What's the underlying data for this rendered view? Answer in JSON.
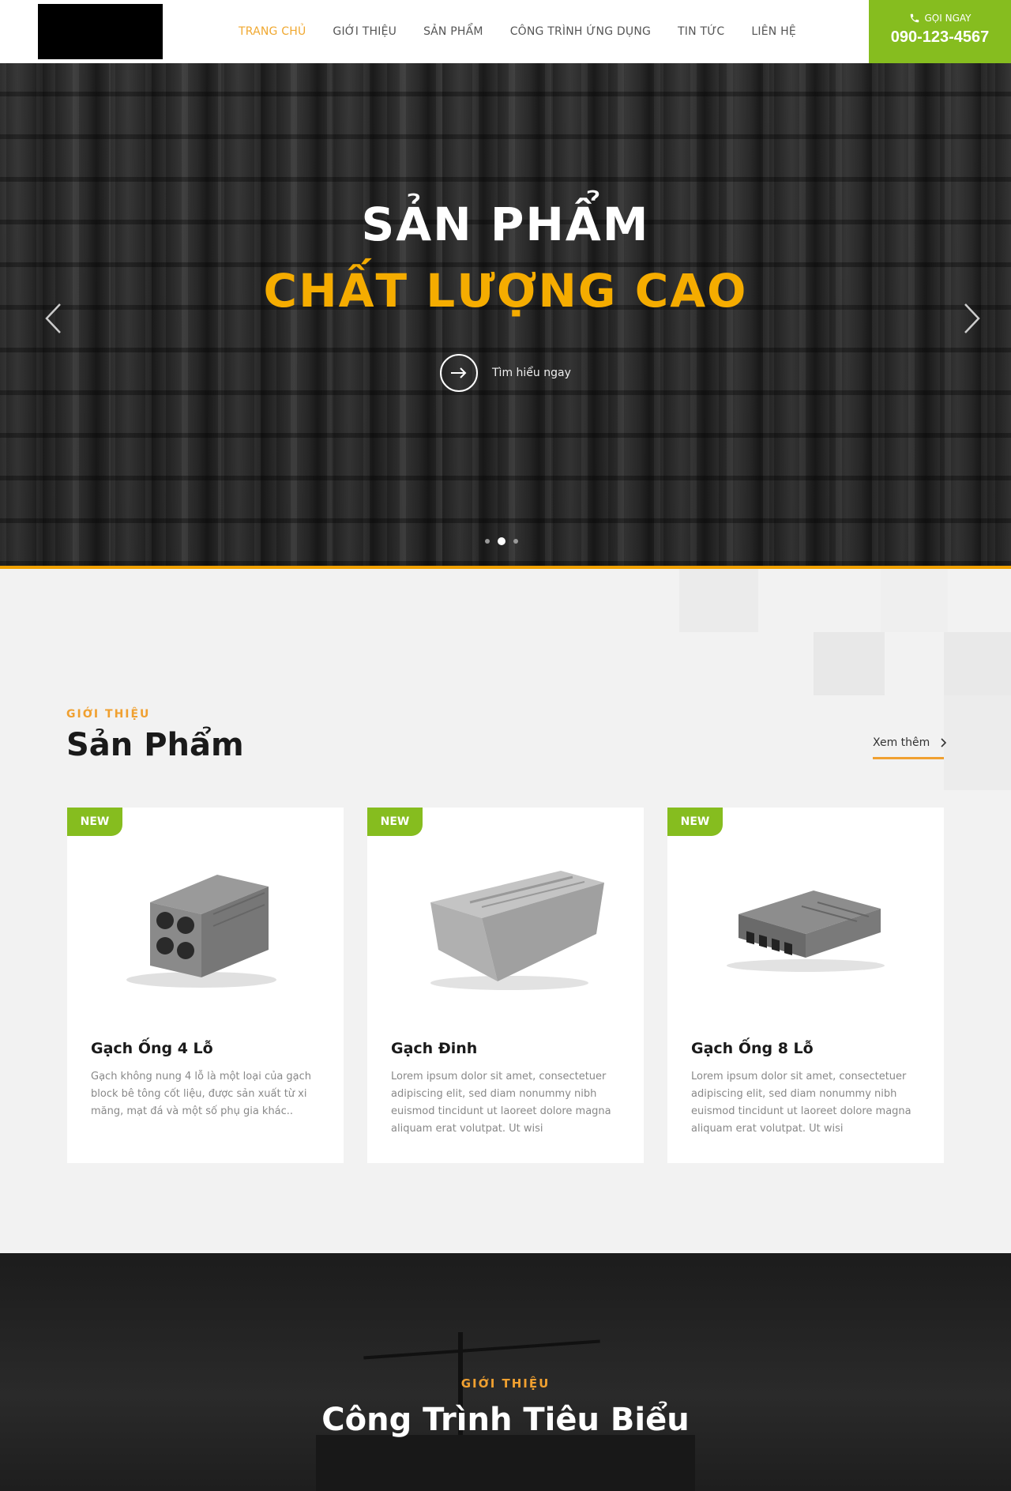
{
  "header": {
    "nav": [
      {
        "label": "TRANG CHỦ",
        "active": true
      },
      {
        "label": "GIỚI THIỆU",
        "active": false
      },
      {
        "label": "SẢN PHẨM",
        "active": false
      },
      {
        "label": "CÔNG TRÌNH ỨNG DỤNG",
        "active": false
      },
      {
        "label": "TIN TỨC",
        "active": false
      },
      {
        "label": "LIÊN HỆ",
        "active": false
      }
    ],
    "call": {
      "label": "GỌI NGAY",
      "phone": "090-123-4567",
      "icon": "phone-icon"
    }
  },
  "hero": {
    "title_line1": "SẢN PHẨM",
    "title_line2": "CHẤT LƯỢNG CAO",
    "cta_label": "Tìm hiểu ngay",
    "prev_icon": "chevron-left-icon",
    "next_icon": "chevron-right-icon",
    "slides": 3,
    "active_slide": 2
  },
  "products": {
    "kicker": "GIỚI THIỆU",
    "title": "Sản Phẩm",
    "see_more": "Xem thêm",
    "items": [
      {
        "badge": "NEW",
        "name": "Gạch Ống 4 Lỗ",
        "description": "Gạch không nung 4 lỗ là một loại của gạch block bê tông cốt liệu, được sản xuất từ xi măng, mạt đá và một số phụ gia khác.."
      },
      {
        "badge": "NEW",
        "name": "Gạch Đinh",
        "description": "Lorem ipsum dolor sit amet, consectetuer adipiscing elit, sed diam nonummy nibh euismod tincidunt ut laoreet dolore magna aliquam erat volutpat. Ut wisi"
      },
      {
        "badge": "NEW",
        "name": "Gạch Ống 8 Lỗ",
        "description": "Lorem ipsum dolor sit amet, consectetuer adipiscing elit, sed diam nonummy nibh euismod tincidunt ut laoreet dolore magna aliquam erat volutpat. Ut wisi"
      }
    ]
  },
  "projects": {
    "kicker": "GIỚI THIỆU",
    "title": "Công Trình Tiêu Biểu"
  },
  "colors": {
    "accent_orange": "#f5ac00",
    "accent_green": "#86bd1f"
  }
}
